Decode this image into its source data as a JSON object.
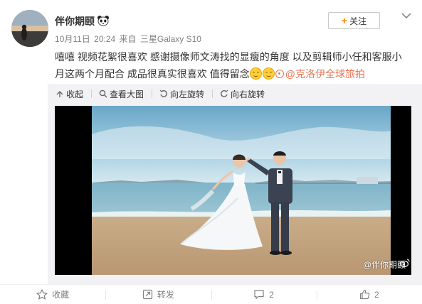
{
  "user": {
    "name": "伴你期颐",
    "badge_icon": "panda-icon"
  },
  "meta": {
    "date": "10月11日",
    "time": "20:24",
    "source_prefix": "来自",
    "device": "三星Galaxy S10"
  },
  "follow_button": {
    "label": "关注",
    "icon": "plus-icon",
    "accent": "#ff8200"
  },
  "post": {
    "text_line1": "嘻嘻 视频花絮很喜欢 感谢摄像师文涛找的显瘦的角度 以及剪辑师小任和客服小",
    "text_line2": "月这两个月配合 成品很真实很喜欢 值得留念",
    "emojis": [
      "smile-emoji",
      "smile-emoji"
    ],
    "mention": "@克洛伊全球旅拍",
    "mention_color": "#eb7350"
  },
  "media_toolbar": {
    "collapse": "收起",
    "view_large": "查看大图",
    "rotate_left": "向左旋转",
    "rotate_right": "向右旋转"
  },
  "photo": {
    "watermark": "@伴你期颐"
  },
  "footer": {
    "favorite": "收藏",
    "repost": "转发",
    "comment_count": "2",
    "like_count": "2"
  }
}
